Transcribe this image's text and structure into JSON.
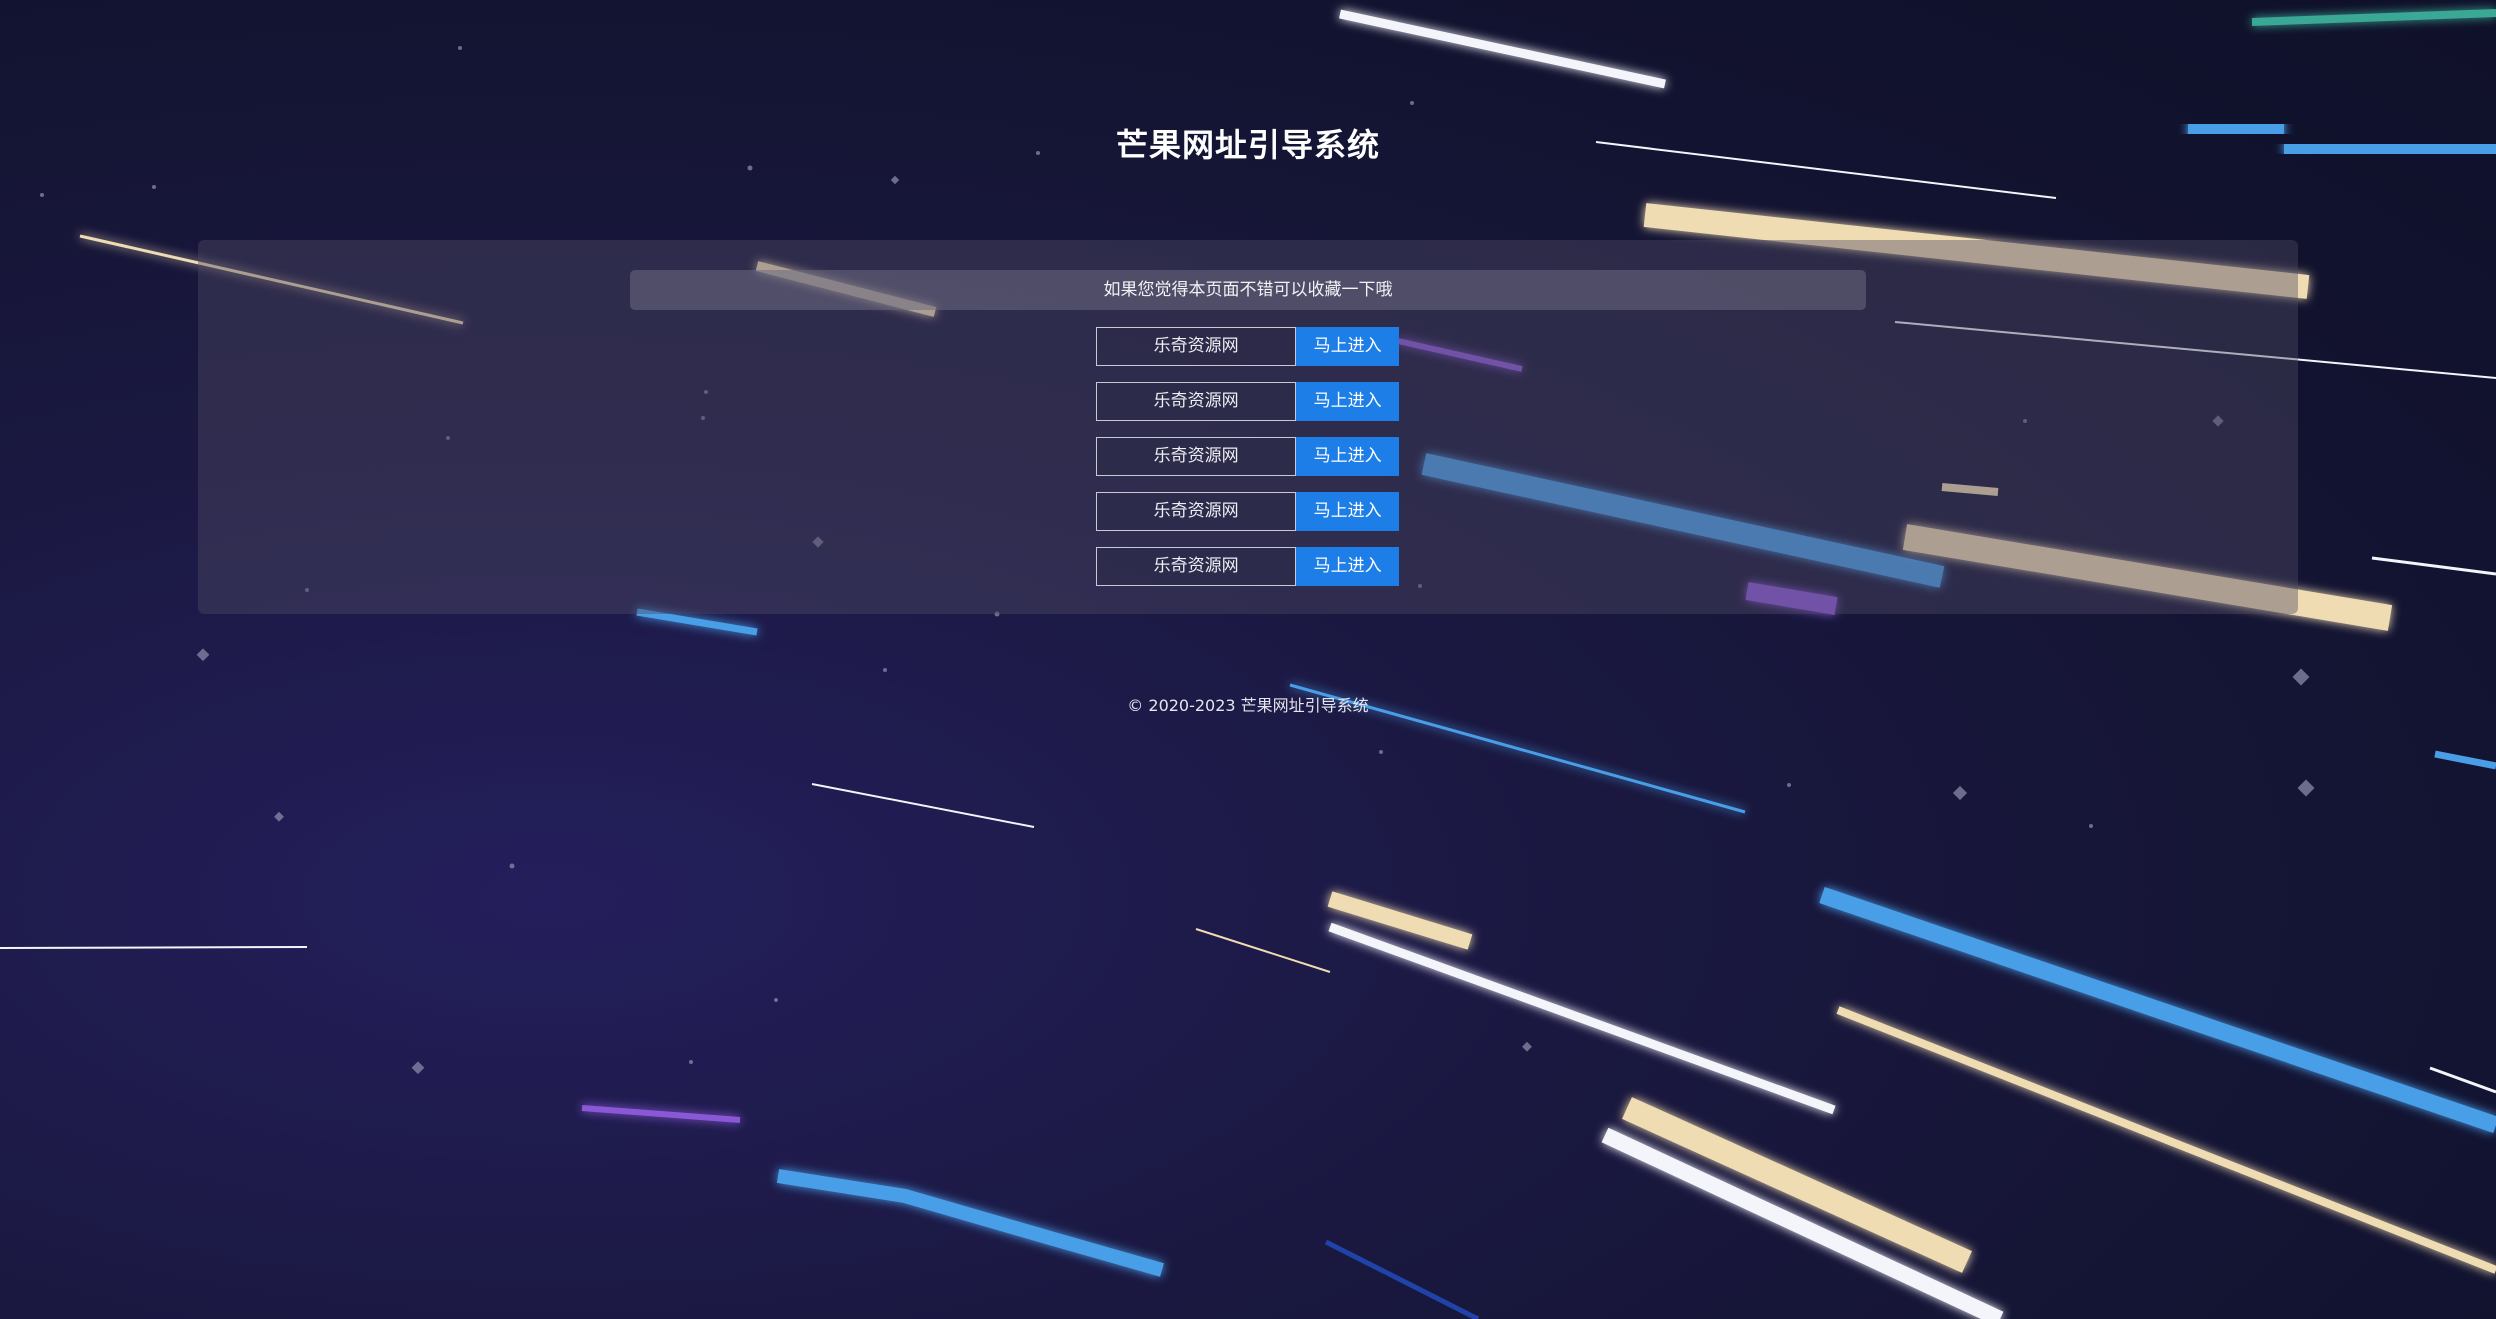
{
  "header": {
    "title": "芒果网址引导系统"
  },
  "main": {
    "notice": "如果您觉得本页面不错可以收藏一下哦",
    "links": [
      {
        "name": "乐奇资源网",
        "button_label": "马上进入"
      },
      {
        "name": "乐奇资源网",
        "button_label": "马上进入"
      },
      {
        "name": "乐奇资源网",
        "button_label": "马上进入"
      },
      {
        "name": "乐奇资源网",
        "button_label": "马上进入"
      },
      {
        "name": "乐奇资源网",
        "button_label": "马上进入"
      }
    ]
  },
  "footer": {
    "copyright": "© 2020-2023 芒果网址引导系统"
  },
  "colors": {
    "background": "#15142e",
    "panel": "#4e4a64",
    "button": "#1e7ee8",
    "streak_white": "#f4f4fb",
    "streak_cream": "#efdcb2",
    "streak_blue": "#4a9ee8",
    "streak_purple": "#8a58d6",
    "streak_teal": "#3aa896"
  }
}
